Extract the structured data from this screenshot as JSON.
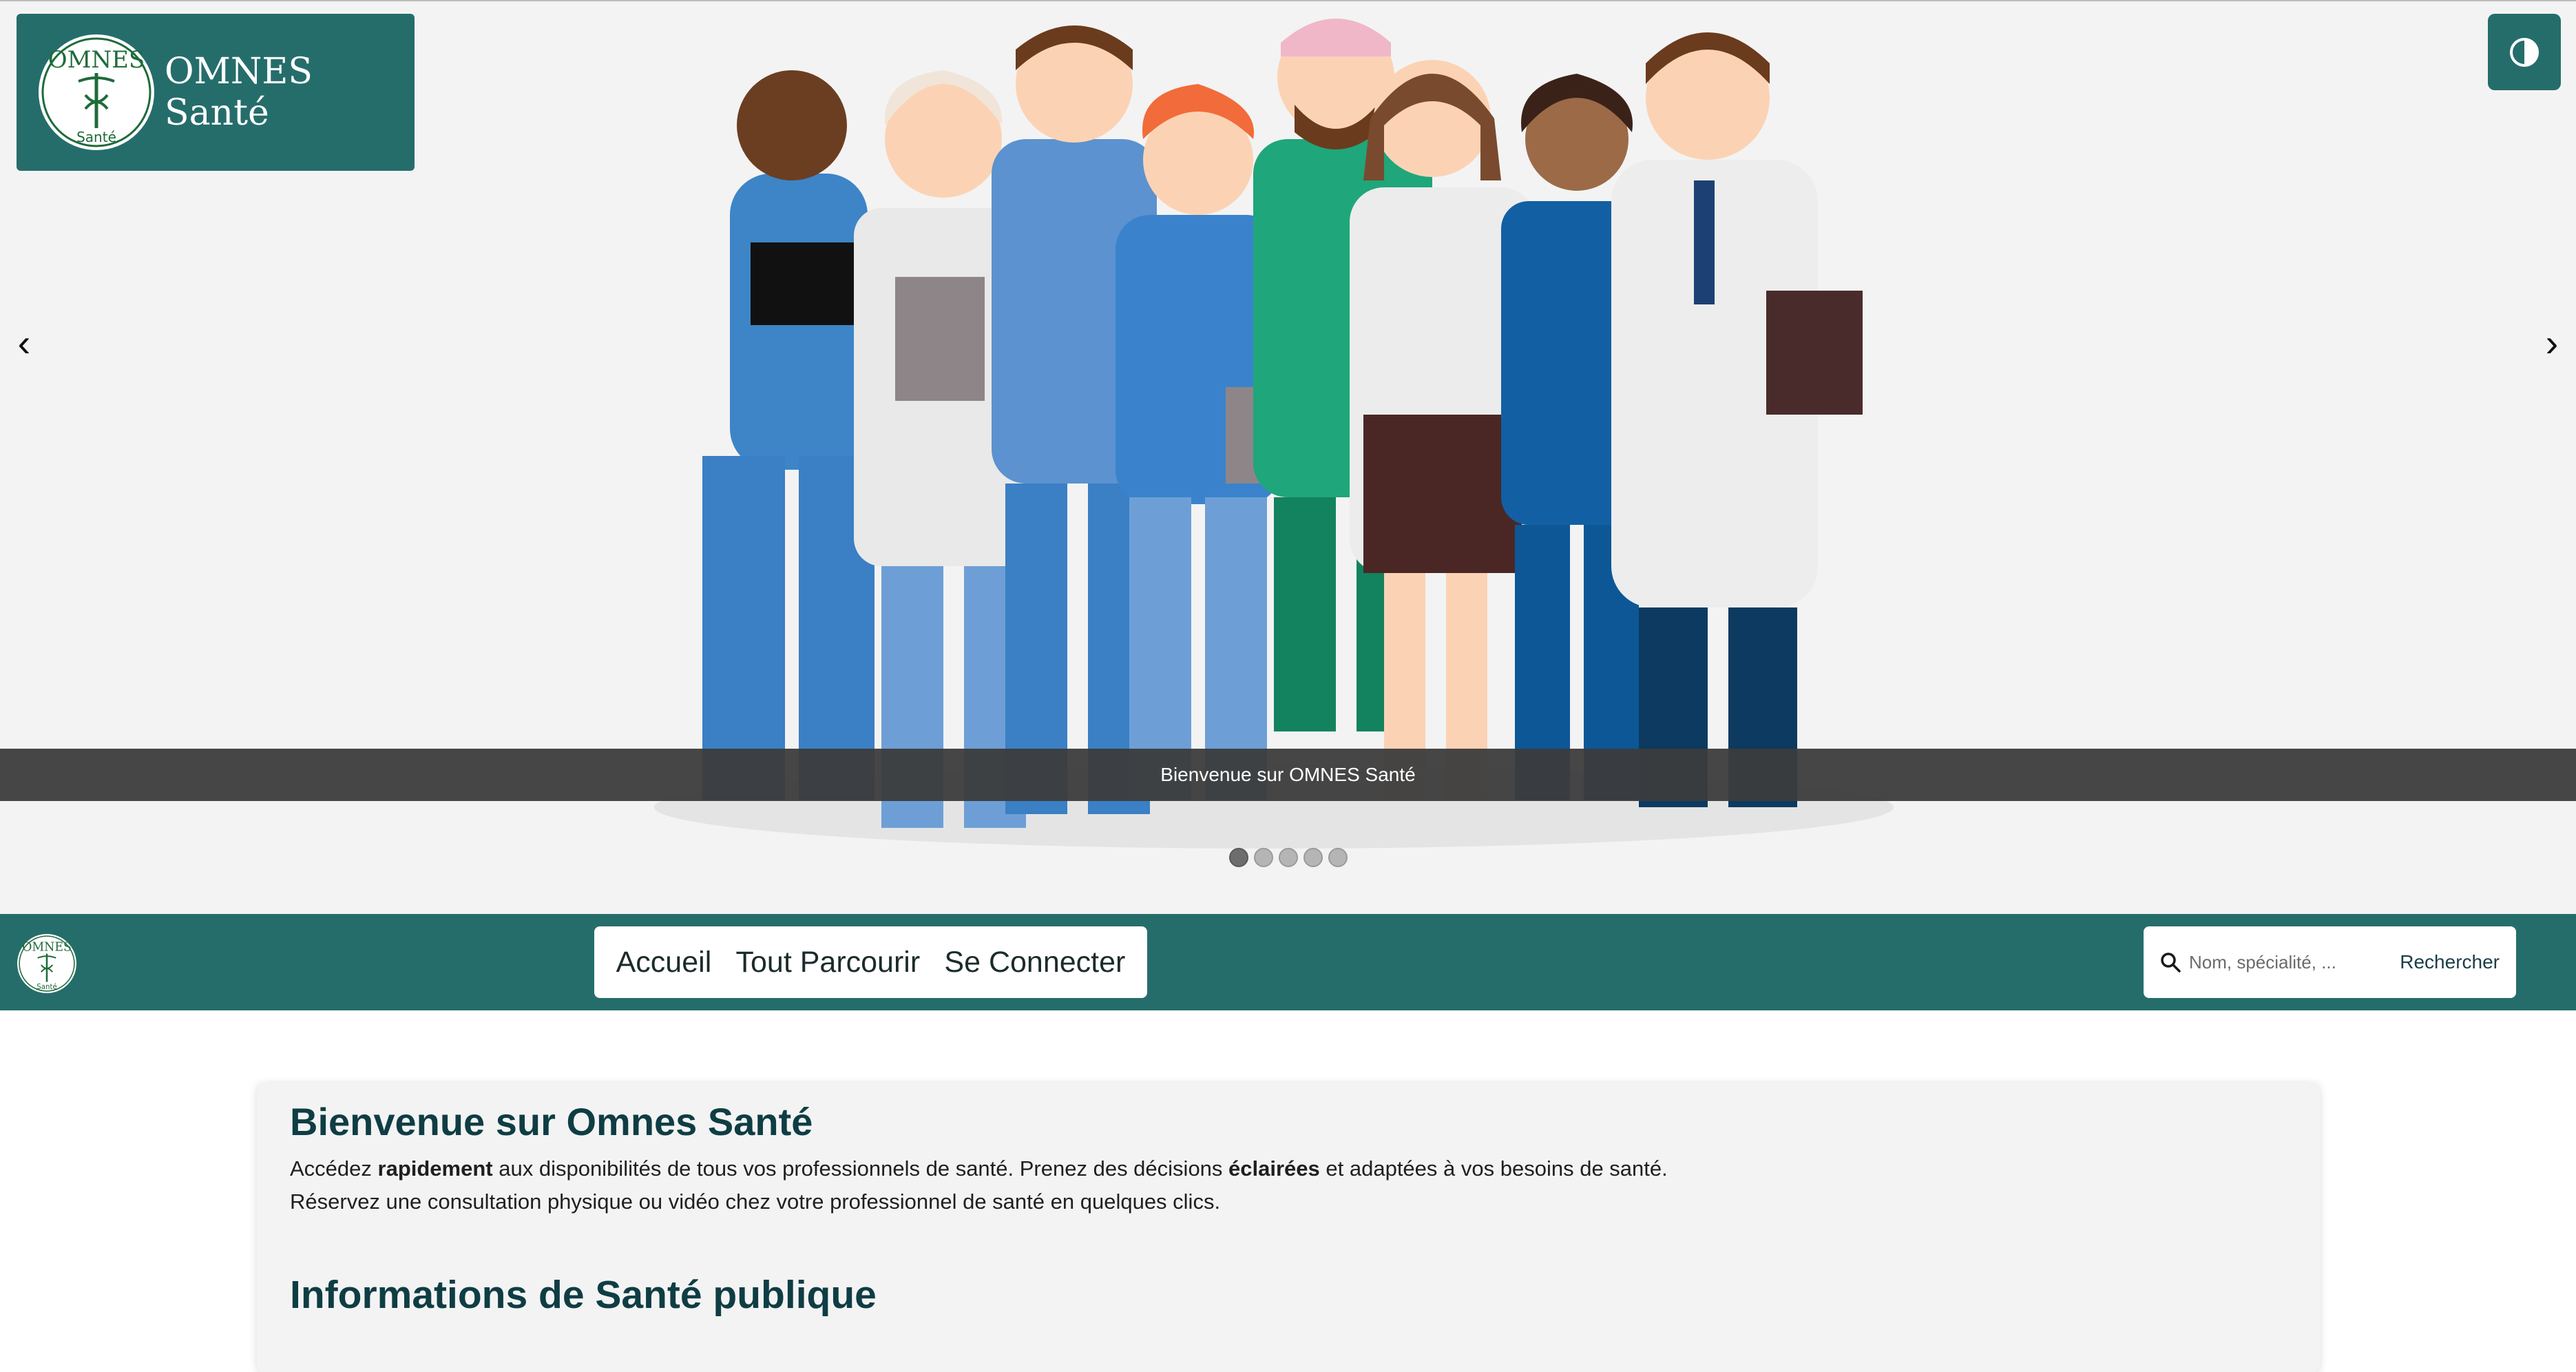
{
  "brand": {
    "name": "OMNES Santé",
    "logo_text": "OMNES",
    "logo_subtext": "Santé"
  },
  "theme_toggle": {
    "icon": "contrast-icon"
  },
  "carousel": {
    "caption": "Bienvenue sur OMNES Santé",
    "slides_count": 5,
    "active_slide": 1,
    "prev_symbol": "‹",
    "next_symbol": "›"
  },
  "nav": {
    "links": [
      "Accueil",
      "Tout Parcourir",
      "Se Connecter"
    ],
    "search_placeholder": "Nom, spécialité, ...",
    "search_button": "Rechercher"
  },
  "main": {
    "title": "Bienvenue sur Omnes Santé",
    "intro_line1_a": "Accédez ",
    "intro_line1_b": "rapidement",
    "intro_line1_c": " aux disponibilités de tous vos professionnels de santé. Prenez des décisions ",
    "intro_line1_d": "éclairées",
    "intro_line1_e": " et adaptées à vos besoins de santé.",
    "intro_line2": "Réservez une consultation physique ou vidéo chez votre professionnel de santé en quelques clics.",
    "section_title": "Informations de Santé publique"
  },
  "colors": {
    "brand": "#256d6b",
    "heading": "#0f3d44",
    "hero_bg": "#f3f3f3"
  }
}
